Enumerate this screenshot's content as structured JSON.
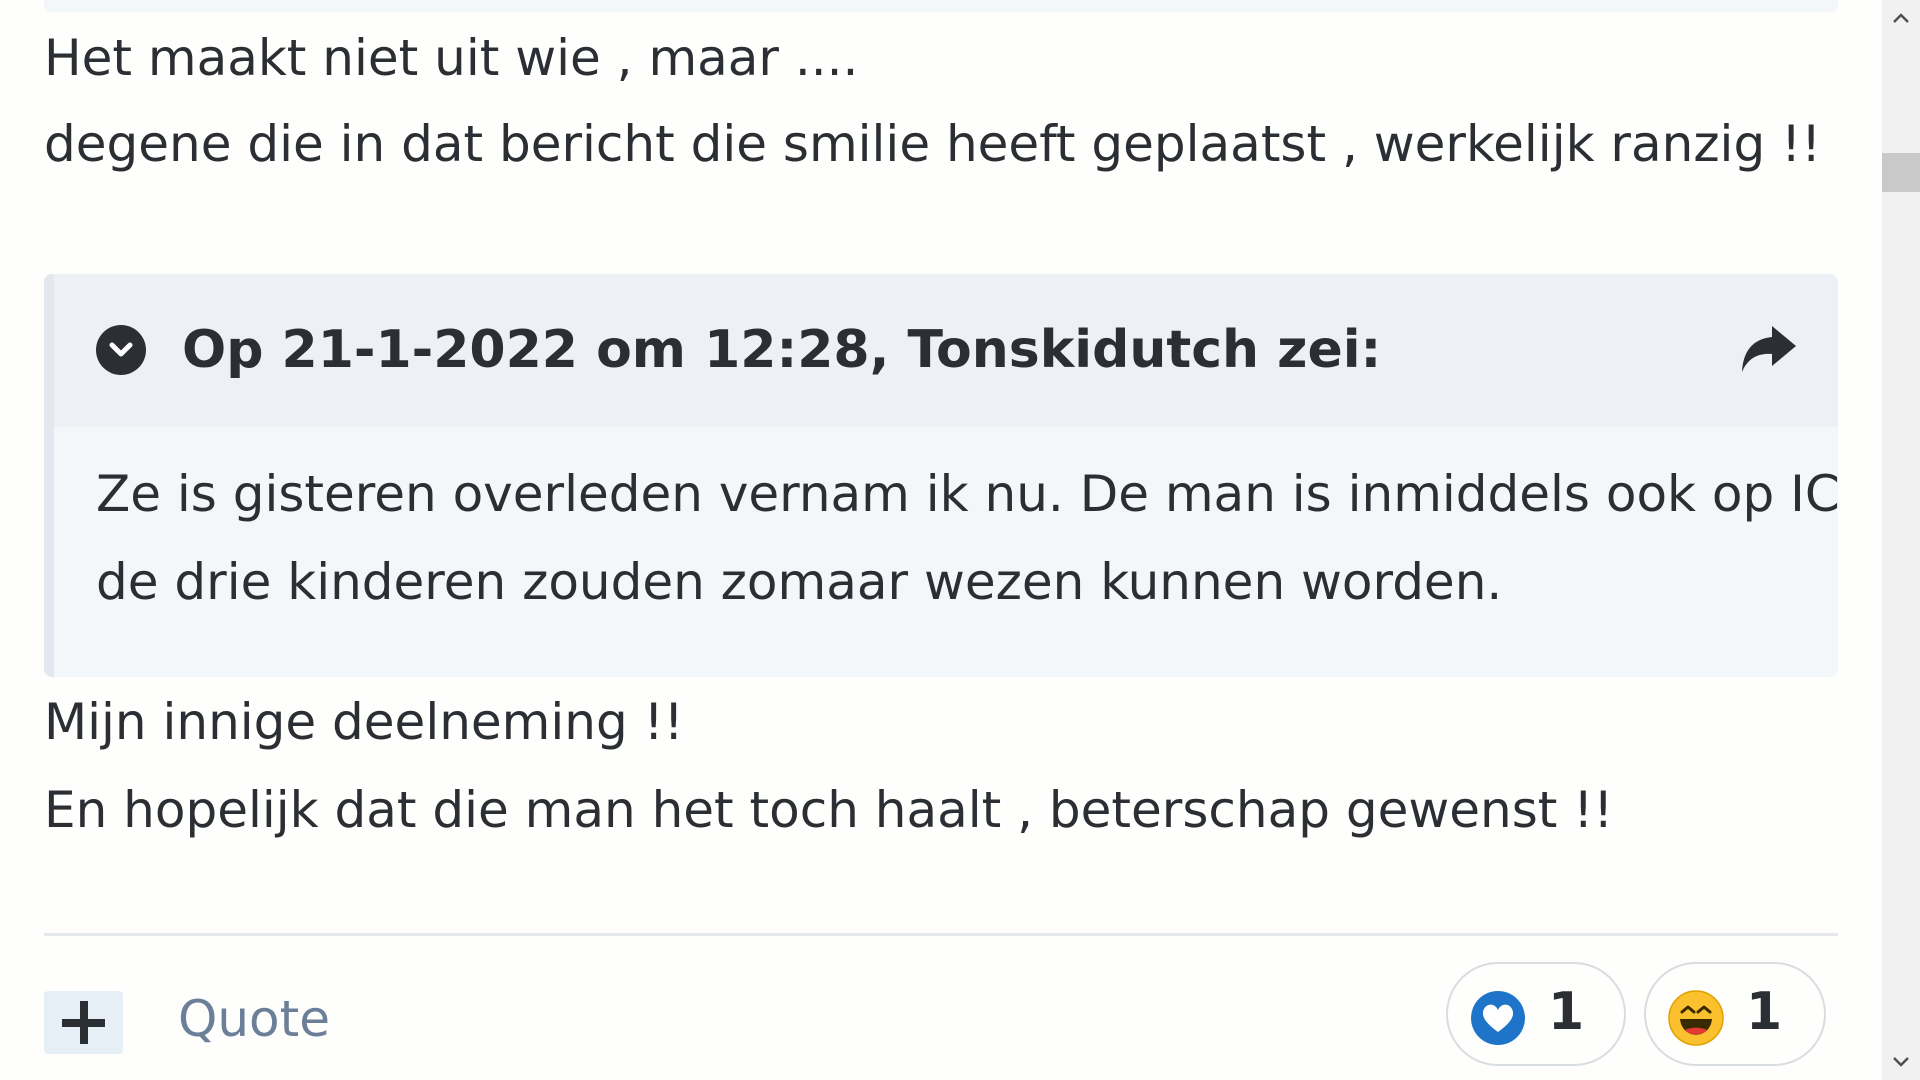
{
  "post": {
    "line_1": "Het maakt niet uit wie , maar ....",
    "line_2": "degene die in dat bericht die smilie heeft geplaatst , werkelijk ranzig !!",
    "line_3": "Mijn innige deelneming !!",
    "line_4": "En hopelijk dat die man het toch haalt , beterschap gewenst !!"
  },
  "quote": {
    "attribution": "Op 21-1-2022 om 12:28, Tonskidutch zei:",
    "body_line_1": "Ze is gisteren overleden vernam ik nu. De man is inmiddels ook op IC en",
    "body_line_2": "de drie kinderen zouden zomaar wezen kunnen worden.",
    "toggle_icon": "chevron-down-circle-icon",
    "share_icon": "share-arrow-icon"
  },
  "footer": {
    "plus_icon": "plus-icon",
    "quote_label": "Quote"
  },
  "reactions": [
    {
      "icon": "heart-icon",
      "count": "1",
      "color": "#1d74c9"
    },
    {
      "icon": "laughing-face-icon",
      "count": "1",
      "color": "#fbc02d"
    }
  ],
  "colors": {
    "text": "#2b2f34",
    "quote_header_bg": "#edf1f6",
    "quote_body_bg": "#f4f7fa",
    "quote_link": "#6b7f98",
    "plus_button_bg": "#e6eef6"
  }
}
